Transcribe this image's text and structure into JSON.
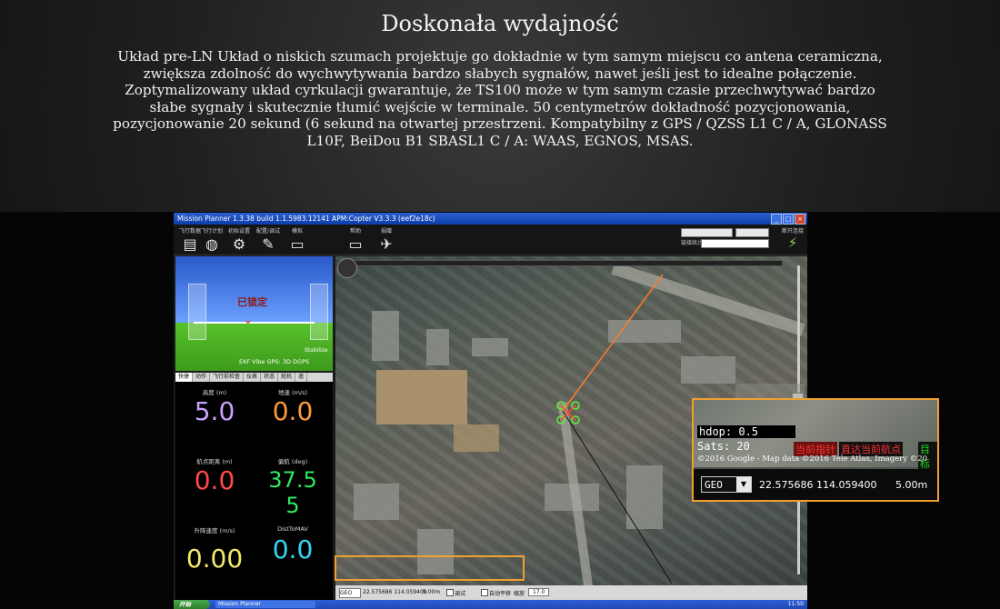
{
  "heading": "Doskonała wydajność",
  "description": "Układ pre-LN Układ o niskich szumach projektuje go dokładnie w tym samym miejscu co antena ceramiczna, zwiększa zdolność do wychwytywania bardzo słabych sygnałów, nawet jeśli jest to idealne połączenie. Zoptymalizowany układ cyrkulacji gwarantuje, że TS100 może w tym samym czasie przechwytywać bardzo słabe sygnały i skutecznie tłumić wejście w terminale. 50 centymetrów dokładność pozycjonowania, pozycjonowanie 20 sekund (6 sekund na otwartej przestrzeni. Kompatybilny z  GPS / QZSS L1 C / A, GLONASS L10F, BeiDou B1 SBASL1 C / A: WAAS, EGNOS, MSAS.",
  "window": {
    "title": "Mission Planner 1.3.38 build 1.1.5983.12141 APM:Copter V3.3.3 (eef2e18c)",
    "controls": [
      "_",
      "□",
      "×"
    ]
  },
  "toolbar": {
    "items": [
      {
        "label": "飞行数据",
        "icon": "flight-data-icon"
      },
      {
        "label": "飞行计划",
        "icon": "globe-icon"
      },
      {
        "label": "初始设置",
        "icon": "gear-icon"
      },
      {
        "label": "配置/调试",
        "icon": "wrench-icon"
      },
      {
        "label": "模拟",
        "icon": "monitor-icon"
      },
      {
        "label": "帮助",
        "icon": "help-monitor-icon"
      },
      {
        "label": "捐赠",
        "icon": "donate-icon"
      }
    ],
    "right_label": "链接统计...",
    "connect_label": "断开连接"
  },
  "hud": {
    "lock_text": "已锁定",
    "status_text": "EKF  Vibe  GPS: 3D DGPS",
    "stabilize_text": "Stabilize"
  },
  "tabs": [
    "快捷",
    "动作",
    "飞行前检查",
    "仪表",
    "状态",
    "舵机",
    "遥"
  ],
  "quick": {
    "cells": [
      {
        "label": "高度 (m)",
        "value": "5.0",
        "color": "#c8a0ff"
      },
      {
        "label": "地速 (m/s)",
        "value": "0.0",
        "color": "#ff9a3c"
      },
      {
        "label": "航点距离 (m)",
        "value": "0.0",
        "color": "#ff4a4a"
      },
      {
        "label": "偏航 (deg)",
        "value": "37.5\n5",
        "color": "#2ee860"
      },
      {
        "label": "升降速度 (m/s)",
        "value": "0.00",
        "color": "#f3e96a"
      },
      {
        "label": "DistToMAV",
        "value": "0.0",
        "color": "#35d6f0"
      }
    ]
  },
  "bottom_bar": {
    "geo": "GEO",
    "coords": "22.575686  114.059400",
    "alt": "5.00m",
    "debug": "调试",
    "auto_pan": "自动平移",
    "zoom_label": "缩放",
    "zoom_value": "17.0"
  },
  "zoom_panel": {
    "hdop": "hdop: 0.5",
    "sats": "Sats: 20",
    "red1": "当前指针",
    "red2": "直达当前航点",
    "green": "目标",
    "copyright": "©2016 Google - Map data ©2016 Tele Atlas, Imagery ©20",
    "geo": "GEO",
    "coords": "22.575686  114.059400",
    "alt": "5.00m"
  },
  "taskbar": {
    "start": "开始",
    "task": "Mission Planner",
    "clock": "11:50"
  }
}
